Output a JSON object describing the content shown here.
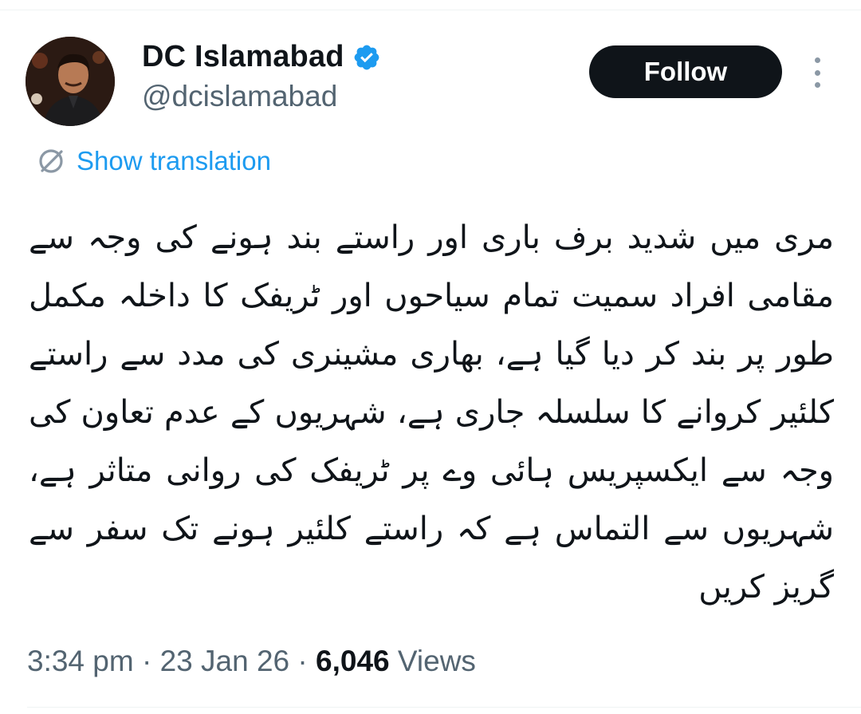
{
  "author": {
    "display_name": "DC Islamabad",
    "handle": "@dcislamabad",
    "verified": true
  },
  "actions": {
    "follow_label": "Follow",
    "more_icon": "more-vertical-icon"
  },
  "translation": {
    "label": "Show translation",
    "icon": "translate-icon"
  },
  "tweet": {
    "text": "مری میں شدید برف باری اور راستے بند ہونے کی وجہ سے مقامی افراد سمیت تمام سیاحوں اور ٹریفک کا داخلہ مکمل طور پر بند کر دیا گیا ہے، بھاری مشینری کی مدد سے راستے کلئیر کروانے کا سلسلہ جاری ہے، شہریوں کے عدم تعاون کی وجہ سے ایکسپریس ہائی وے پر ٹریفک کی روانی متاثر ہے، شہریوں سے التماس ہے کہ راستے کلئیر ہونے تک سفر سے گریز کریں"
  },
  "meta": {
    "time": "3:34 pm",
    "separator": " · ",
    "date": "23 Jan 26",
    "views_count": "6,046",
    "views_label": "Views"
  },
  "colors": {
    "accent": "#1d9bf0",
    "text_primary": "#0f1419",
    "text_secondary": "#536471",
    "follow_bg": "#0f1419"
  }
}
